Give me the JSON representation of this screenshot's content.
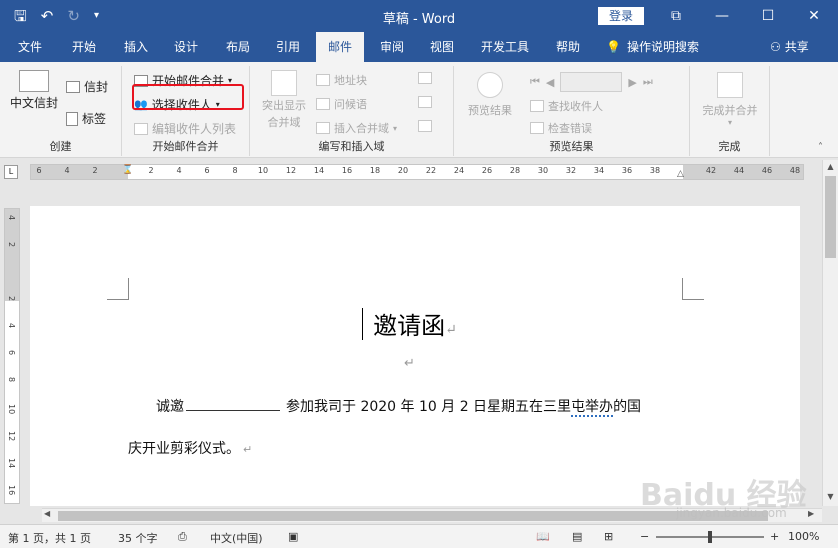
{
  "titlebar": {
    "save_icon": "save-icon",
    "undo_icon": "undo-icon",
    "redo_icon": "redo-icon",
    "title": "草稿 - Word",
    "login": "登录"
  },
  "tabs": [
    "文件",
    "开始",
    "插入",
    "设计",
    "布局",
    "引用",
    "邮件",
    "审阅",
    "视图",
    "开发工具",
    "帮助"
  ],
  "active_tab": "邮件",
  "tell_me": "操作说明搜索",
  "share": "共享",
  "ribbon": {
    "create": {
      "label": "创建",
      "chinese_envelope": "中文信封",
      "envelope": "信封",
      "labels": "标签"
    },
    "start_merge": {
      "label": "开始邮件合并",
      "start_mail_merge": "开始邮件合并",
      "select_recipients": "选择收件人",
      "edit_recipients": "编辑收件人列表"
    },
    "write_insert": {
      "label": "编写和插入域",
      "highlight_fields_1": "突出显示",
      "highlight_fields_2": "合并域",
      "address_block": "地址块",
      "greeting_line": "问候语",
      "insert_merge_field": "插入合并域"
    },
    "preview": {
      "label": "预览结果",
      "preview_results": "预览结果",
      "find_recipient": "查找收件人",
      "check_errors": "检查错误"
    },
    "finish": {
      "label": "完成",
      "finish_merge": "完成并合并"
    }
  },
  "ruler": {
    "tab_marker": "L",
    "numbers": [
      "6",
      "4",
      "2",
      "",
      "2",
      "4",
      "6",
      "8",
      "10",
      "12",
      "14",
      "16",
      "18",
      "20",
      "22",
      "24",
      "26",
      "28",
      "30",
      "32",
      "34",
      "36",
      "38",
      "",
      "42",
      "44",
      "46",
      "48"
    ],
    "vnumbers": [
      "4",
      "2",
      "",
      "2",
      "4",
      "6",
      "8",
      "10",
      "12",
      "14",
      "16"
    ]
  },
  "document": {
    "heading": "邀请函",
    "paragraph_mark": "↵",
    "line1_before": "诚邀",
    "line1_after": "参加我司于 2020 年 10 月 2 日星期五在三里",
    "line1_squiggle": "屯举办",
    "line1_end": "的国",
    "line2": "庆开业剪彩仪式。"
  },
  "status": {
    "page": "第 1 页，共 1 页",
    "words": "35 个字",
    "language": "中文(中国)",
    "zoom": "100%"
  },
  "watermark": {
    "main": "Baidu 经验",
    "sub": "jingyan.baidu.com"
  }
}
